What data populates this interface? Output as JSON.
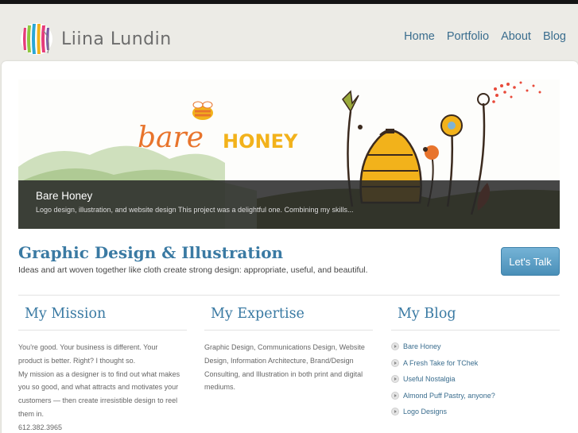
{
  "site": {
    "name": "Liina Lundin"
  },
  "nav": [
    {
      "label": "Home"
    },
    {
      "label": "Portfolio"
    },
    {
      "label": "About"
    },
    {
      "label": "Blog"
    }
  ],
  "hero": {
    "artwork_word_1": "bare",
    "artwork_word_2": "HONEY",
    "title": "Bare Honey",
    "description": "Logo design, illustration, and website design This project was a delightful one. Combining my skills..."
  },
  "intro": {
    "headline": "Graphic Design & Illustration",
    "tagline": "Ideas and art woven together like cloth create strong design: appropriate, useful, and beautiful.",
    "cta_label": "Let's Talk"
  },
  "mission": {
    "heading": "My Mission",
    "lines": [
      "You're good. Your business is different. Your",
      "product is better. Right? I thought so.",
      "My mission as a designer is to find out what makes",
      "you so good, and what attracts and motivates your",
      "customers — then create irresistible design to reel",
      "them in.",
      "612.382.3965"
    ]
  },
  "expertise": {
    "heading": "My Expertise",
    "lines": [
      "Graphic Design, Communications Design, Website",
      "Design, Information Architecture, Brand/Design",
      "Consulting, and Illustration in both print and digital",
      "mediums."
    ]
  },
  "blog": {
    "heading": "My Blog",
    "posts": [
      "Bare Honey",
      "A Fresh Take for TChek",
      "Useful Nostalgia",
      "Almond Puff Pastry, anyone?",
      "Logo Designs"
    ]
  },
  "colors": {
    "link": "#3a6d8e",
    "heading": "#3a7aa3",
    "cta": "#5a9fc6",
    "honey_orange": "#e8742c",
    "honey_yellow": "#f2b21b"
  }
}
